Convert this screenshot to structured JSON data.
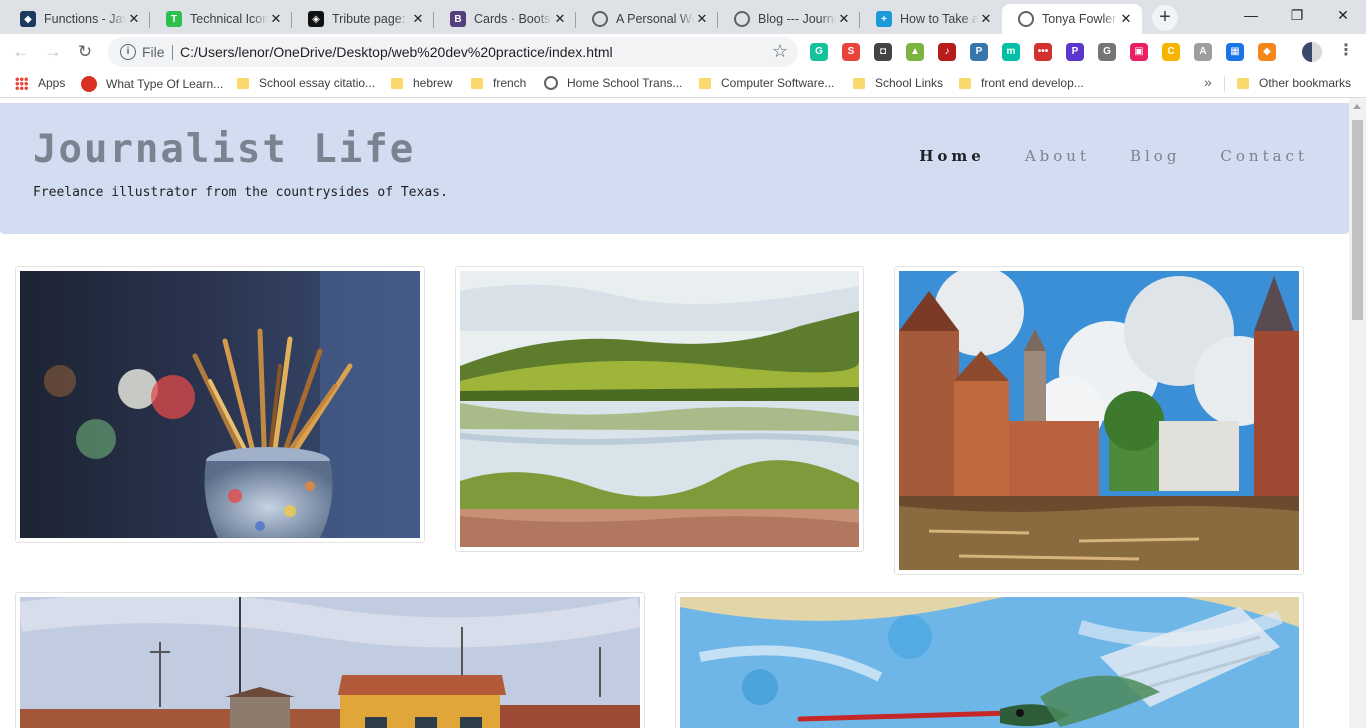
{
  "browser": {
    "tabs": [
      {
        "title": "Functions - JavaScript | MDN",
        "favicon_color": "#1b3a5c",
        "favicon_glyph": "◆"
      },
      {
        "title": "Technical Icons",
        "favicon_color": "#2fbf4f",
        "favicon_glyph": "T"
      },
      {
        "title": "Tribute page: Codepen",
        "favicon_color": "#111111",
        "favicon_glyph": "◈"
      },
      {
        "title": "Cards · Bootstrap",
        "favicon_color": "#563d7c",
        "favicon_glyph": "B"
      },
      {
        "title": "A Personal Website",
        "favicon_color": "#5f6368",
        "favicon_glyph": ""
      },
      {
        "title": "Blog --- Journalist Life",
        "favicon_color": "#5f6368",
        "favicon_glyph": ""
      },
      {
        "title": "How to Take a Screenshot",
        "favicon_color": "#1a9ad6",
        "favicon_glyph": "+"
      },
      {
        "title": "Tonya Fowler",
        "favicon_color": "#5f6368",
        "favicon_glyph": ""
      }
    ],
    "new_tab_label": "+",
    "window_controls": {
      "minimize": "—",
      "restore": "❐",
      "close": "✕"
    },
    "address": {
      "scheme": "File",
      "url": "C:/Users/lenor/OneDrive/Desktop/web%20dev%20practice/index.html"
    },
    "extensions": [
      {
        "name": "grammarly-icon",
        "color": "#15c39a",
        "glyph": "G"
      },
      {
        "name": "adblock-icon",
        "color": "#e8443a",
        "glyph": "S"
      },
      {
        "name": "idea-icon",
        "color": "#444444",
        "glyph": "◘"
      },
      {
        "name": "plant-icon",
        "color": "#7cb342",
        "glyph": "▲"
      },
      {
        "name": "audio-icon",
        "color": "#b71c1c",
        "glyph": "♪"
      },
      {
        "name": "python-icon",
        "color": "#3776ab",
        "glyph": "P"
      },
      {
        "name": "m-icon",
        "color": "#00bfa5",
        "glyph": "m"
      },
      {
        "name": "dots-icon",
        "color": "#d32f2f",
        "glyph": "•••"
      },
      {
        "name": "p-badge-icon",
        "color": "#5c35cc",
        "glyph": "P"
      },
      {
        "name": "g-gray-icon",
        "color": "#757575",
        "glyph": "G"
      },
      {
        "name": "window-icon",
        "color": "#e91e63",
        "glyph": "▣"
      },
      {
        "name": "coupon-icon",
        "color": "#f4b400",
        "glyph": "C"
      },
      {
        "name": "font-icon",
        "color": "#9e9e9e",
        "glyph": "A"
      },
      {
        "name": "calculator-icon",
        "color": "#1a73e8",
        "glyph": "▦"
      },
      {
        "name": "metamask-icon",
        "color": "#f6851b",
        "glyph": "◆"
      }
    ],
    "bookmarks": [
      {
        "label": "Apps",
        "kind": "apps"
      },
      {
        "label": "What Type Of Learn...",
        "kind": "red"
      },
      {
        "label": "School essay citatio...",
        "kind": "folder"
      },
      {
        "label": "hebrew",
        "kind": "folder"
      },
      {
        "label": "french",
        "kind": "folder"
      },
      {
        "label": "Home School Trans...",
        "kind": "globe"
      },
      {
        "label": "Computer Software...",
        "kind": "folder"
      },
      {
        "label": "School Links",
        "kind": "folder"
      },
      {
        "label": "front end develop...",
        "kind": "folder"
      }
    ],
    "bookmarks_overflow": "»",
    "other_bookmarks": "Other bookmarks"
  },
  "site": {
    "title": "Journalist Life",
    "tagline": "Freelance illustrator from the countrysides of Texas.",
    "nav": [
      {
        "label": "Home",
        "active": true
      },
      {
        "label": "About",
        "active": false
      },
      {
        "label": "Blog",
        "active": false
      },
      {
        "label": "Contact",
        "active": false
      }
    ],
    "gallery": [
      {
        "subject": "paint-brushes-jar"
      },
      {
        "subject": "watercolor-landscape"
      },
      {
        "subject": "canal-city-painting"
      },
      {
        "subject": "rooftops-photo"
      },
      {
        "subject": "hummingbird-painting"
      }
    ]
  }
}
